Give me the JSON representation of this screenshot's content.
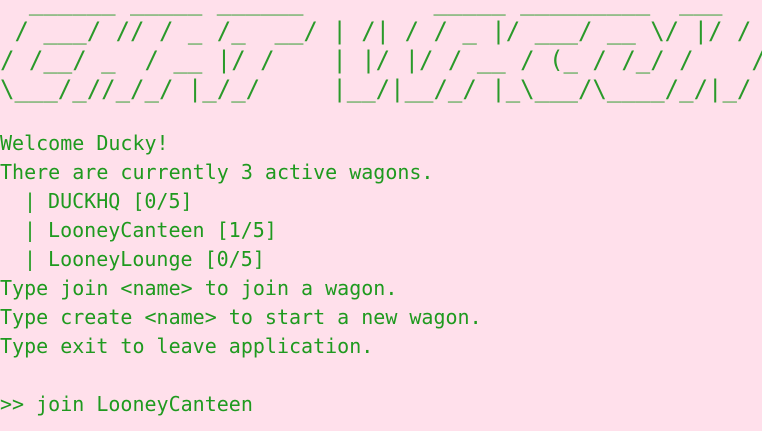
{
  "banner": {
    "ascii_art": "  ______ _____ ______         _____ _________  ___\n / ___/ // / _ /_  __/ | /| / / _ |/ ___/ __ \\/ |/ /\n/ /__/ _  / __ |/ /    | |/ |/ / __ / (_ / /_/ /    /\n\\___/_//_/_/ |_/_/     |__/|__/_/ |_\\___/\\____/_/|_/"
  },
  "welcome": "Welcome Ducky!",
  "status": "There are currently 3 active wagons.",
  "wagons": [
    {
      "bar": "|",
      "name": "DUCKHQ",
      "occupancy": "[0/5]"
    },
    {
      "bar": "|",
      "name": "LooneyCanteen",
      "occupancy": "[1/5]"
    },
    {
      "bar": "|",
      "name": "LooneyLounge",
      "occupancy": "[0/5]"
    }
  ],
  "instructions": [
    "Type join <name> to join a wagon.",
    "Type create <name> to start a new wagon.",
    "Type exit to leave application."
  ],
  "prompt": {
    "symbol": ">>",
    "value": "join LooneyCanteen"
  },
  "colors": {
    "background": "#ffe0eb",
    "text": "#1f9a1f"
  }
}
